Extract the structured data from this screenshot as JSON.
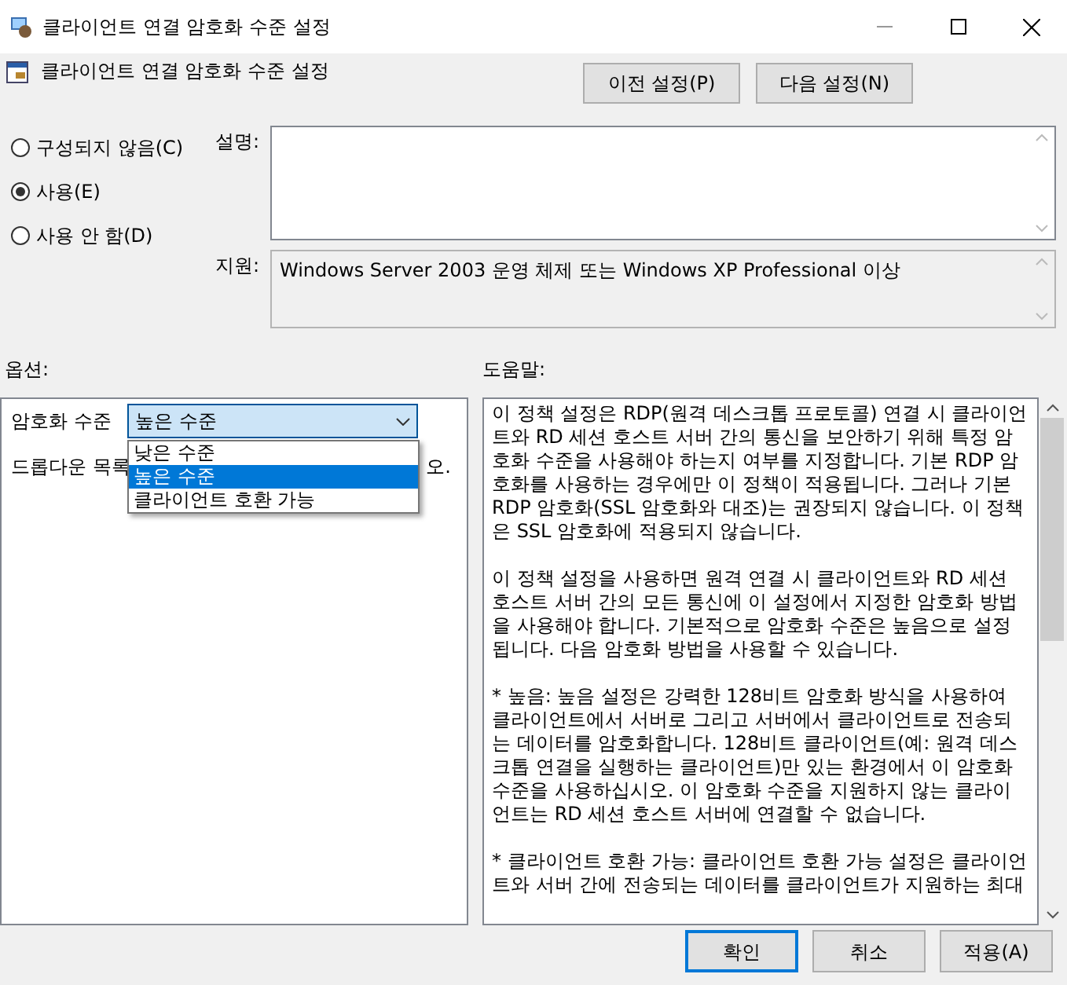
{
  "window": {
    "title": "클라이언트 연결 암호화 수준 설정"
  },
  "heading": "클라이언트 연결 암호화 수준 설정",
  "nav_buttons": [
    "이전 설정(P)",
    "다음 설정(N)"
  ],
  "state_options": [
    {
      "label": "구성되지 않음(C)",
      "selected": false
    },
    {
      "label": "사용(E)",
      "selected": true
    },
    {
      "label": "사용 안 함(D)",
      "selected": false
    }
  ],
  "comment": {
    "label": "설명:"
  },
  "supported": {
    "label": "지원:",
    "value": "Windows Server 2003 운영 체제 또는 Windows XP Professional 이상"
  },
  "options": {
    "label": "옵션:",
    "field_label": "암호화 수준",
    "value": "높은 수준",
    "dropdown_items": [
      {
        "label": "낮은 수준",
        "selected": false
      },
      {
        "label": "높은 수준",
        "selected": true
      },
      {
        "label": "클라이언트 호환 가능",
        "selected": false
      }
    ],
    "hint_start": "드롭다운 목록",
    "hint_end": "오."
  },
  "help": {
    "label": "도움말:",
    "paragraphs": [
      "이 정책 설정은 RDP(원격 데스크톱 프로토콜) 연결 시 클라이언트와 RD 세션 호스트 서버 간의 통신을 보안하기 위해 특정 암호화 수준을 사용해야 하는지 여부를 지정합니다. 기본 RDP 암호화를 사용하는 경우에만 이 정책이 적용됩니다. 그러나 기본 RDP 암호화(SSL 암호화와 대조)는 권장되지 않습니다. 이 정책은 SSL 암호화에 적용되지 않습니다.",
      "이 정책 설정을 사용하면 원격 연결 시 클라이언트와 RD 세션 호스트 서버 간의 모든 통신에 이 설정에서 지정한 암호화 방법을 사용해야 합니다. 기본적으로 암호화 수준은 높음으로 설정됩니다. 다음 암호화 방법을 사용할 수 있습니다.",
      "* 높음: 높음 설정은 강력한 128비트 암호화 방식을 사용하여 클라이언트에서 서버로 그리고 서버에서 클라이언트로 전송되는 데이터를 암호화합니다. 128비트 클라이언트(예: 원격 데스크톱 연결을 실행하는 클라이언트)만 있는 환경에서 이 암호화 수준을 사용하십시오. 이 암호화 수준을 지원하지 않는 클라이언트는 RD 세션 호스트 서버에 연결할 수 없습니다.",
      "* 클라이언트 호환 가능: 클라이언트 호환 가능 설정은 클라이언트와 서버 간에 전송되는 데이터를 클라이언트가 지원하는 최대"
    ]
  },
  "footer_buttons": [
    {
      "label": "확인",
      "default": true
    },
    {
      "label": "취소",
      "default": false
    },
    {
      "label": "적용(A)",
      "default": false
    }
  ]
}
